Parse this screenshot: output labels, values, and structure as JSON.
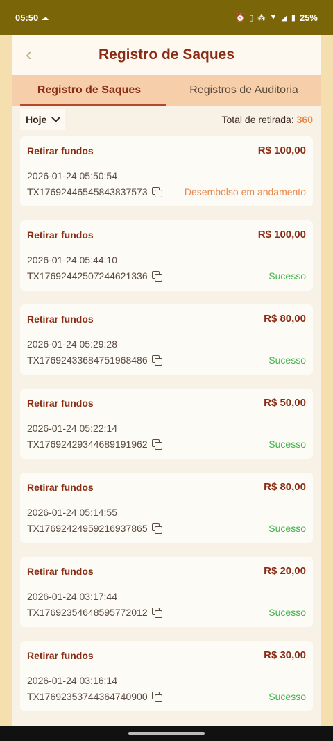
{
  "status_bar": {
    "time": "05:50",
    "battery": "25%"
  },
  "header": {
    "title": "Registro de Saques",
    "back_icon": "chevron-left-icon"
  },
  "tabs": [
    {
      "label": "Registro de Saques",
      "active": true
    },
    {
      "label": "Registros de Auditoria",
      "active": false
    }
  ],
  "filter": {
    "value": "Hoje"
  },
  "total": {
    "label": "Total de retirada:",
    "value": "360"
  },
  "colors": {
    "pending": "#e8874a",
    "success": "#3cb54a",
    "accent": "#8a2c14"
  },
  "records": [
    {
      "title": "Retirar fundos",
      "amount": "R$ 100,00",
      "datetime": "2026-01-24 05:50:54",
      "txid": "TX17692446545843837573",
      "status": "Desembolso em andamento",
      "status_type": "pending"
    },
    {
      "title": "Retirar fundos",
      "amount": "R$ 100,00",
      "datetime": "2026-01-24 05:44:10",
      "txid": "TX17692442507244621336",
      "status": "Sucesso",
      "status_type": "success"
    },
    {
      "title": "Retirar fundos",
      "amount": "R$ 80,00",
      "datetime": "2026-01-24 05:29:28",
      "txid": "TX17692433684751968486",
      "status": "Sucesso",
      "status_type": "success"
    },
    {
      "title": "Retirar fundos",
      "amount": "R$ 50,00",
      "datetime": "2026-01-24 05:22:14",
      "txid": "TX17692429344689191962",
      "status": "Sucesso",
      "status_type": "success"
    },
    {
      "title": "Retirar fundos",
      "amount": "R$ 80,00",
      "datetime": "2026-01-24 05:14:55",
      "txid": "TX17692424959216937865",
      "status": "Sucesso",
      "status_type": "success"
    },
    {
      "title": "Retirar fundos",
      "amount": "R$ 20,00",
      "datetime": "2026-01-24 03:17:44",
      "txid": "TX17692354648595772012",
      "status": "Sucesso",
      "status_type": "success"
    },
    {
      "title": "Retirar fundos",
      "amount": "R$ 30,00",
      "datetime": "2026-01-24 03:16:14",
      "txid": "TX17692353744364740900",
      "status": "Sucesso",
      "status_type": "success"
    }
  ]
}
